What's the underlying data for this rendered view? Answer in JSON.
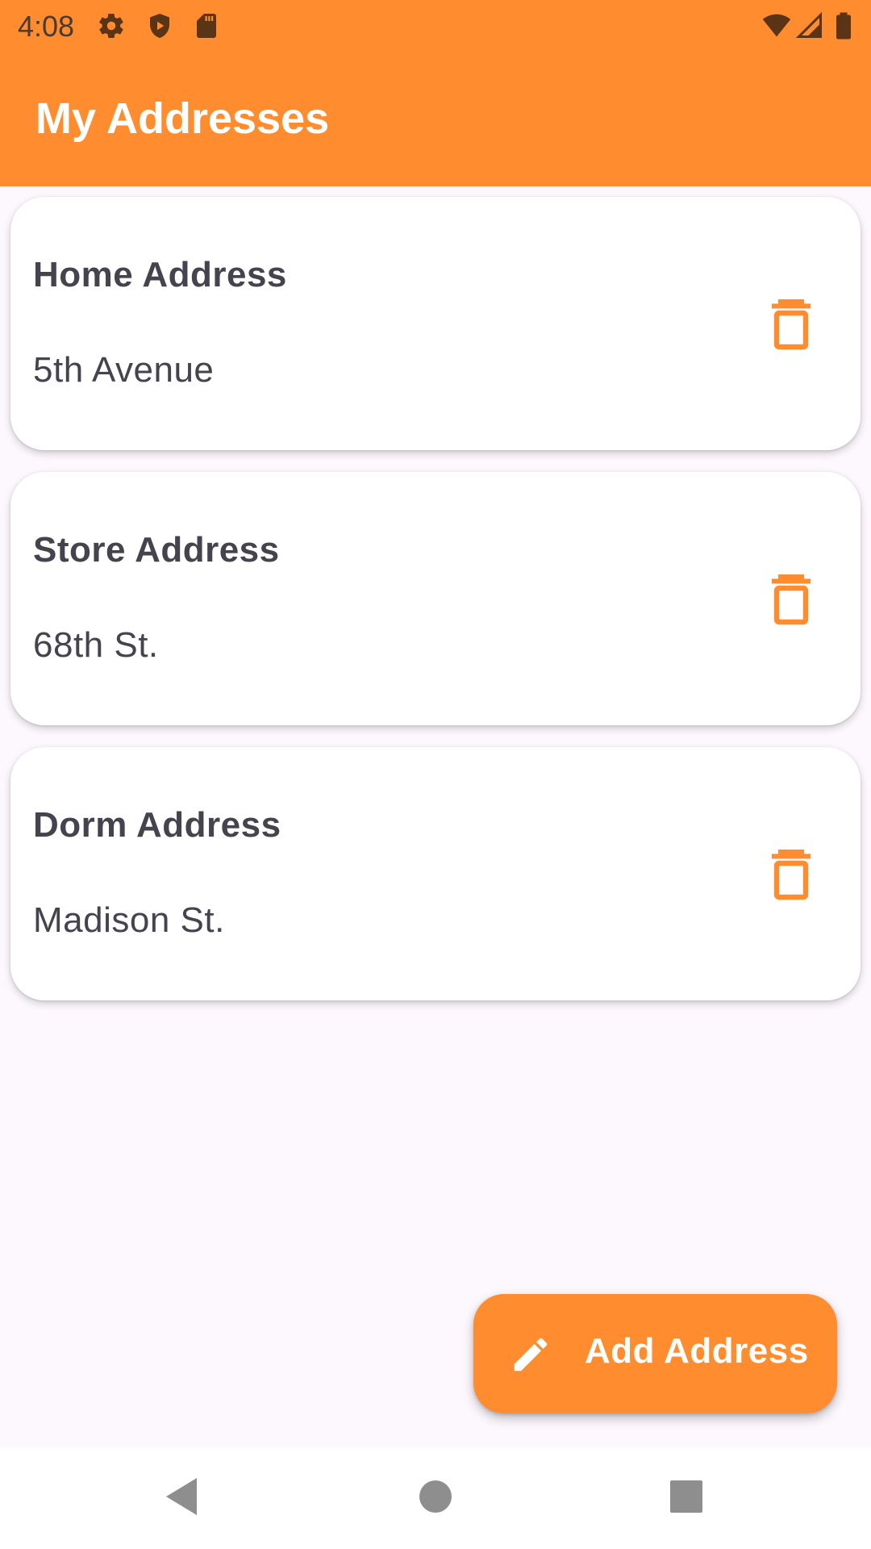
{
  "status_bar": {
    "time": "4:08",
    "left_icons": [
      "gear-icon",
      "shield-play-icon",
      "sd-card-icon"
    ],
    "right_icons": [
      "wifi-icon",
      "signal-icon",
      "battery-icon"
    ]
  },
  "app_bar": {
    "title": "My Addresses"
  },
  "addresses": [
    {
      "title": "Home Address",
      "subtitle": "5th Avenue",
      "action_icon": "trash-icon"
    },
    {
      "title": "Store Address",
      "subtitle": "68th St.",
      "action_icon": "trash-icon"
    },
    {
      "title": "Dorm Address",
      "subtitle": "Madison St.",
      "action_icon": "trash-icon"
    }
  ],
  "fab": {
    "label": "Add Address",
    "icon": "pencil-icon"
  },
  "nav_bar": {
    "buttons": [
      "back-icon",
      "home-icon",
      "recents-icon"
    ]
  },
  "colors": {
    "primary": "#ff8c2e",
    "background": "#fdf8fd",
    "card": "#ffffff",
    "text": "#45434e",
    "nav_icon": "#8e8e8e"
  }
}
